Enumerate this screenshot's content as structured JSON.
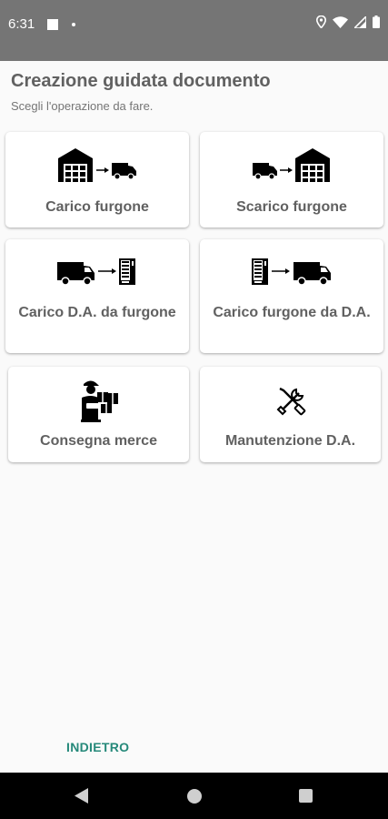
{
  "status_bar": {
    "time": "6:31"
  },
  "header": {
    "title": "Creazione guidata documento",
    "subtitle": "Scegli l'operazione da fare."
  },
  "operations": [
    {
      "label": "Carico furgone",
      "icon": "warehouse-to-van-icon"
    },
    {
      "label": "Scarico furgone",
      "icon": "van-to-warehouse-icon"
    },
    {
      "label": "Carico D.A. da furgone",
      "icon": "van-to-vending-machine-icon"
    },
    {
      "label": "Carico furgone da D.A.",
      "icon": "vending-machine-to-van-icon"
    },
    {
      "label": "Consegna merce",
      "icon": "delivery-person-icon"
    },
    {
      "label": "Manutenzione D.A.",
      "icon": "tools-icon"
    }
  ],
  "footer": {
    "back_label": "INDIETRO"
  },
  "colors": {
    "status_bar": "#757575",
    "accent": "#26897a",
    "text": "#616161",
    "background": "#fafafa"
  }
}
